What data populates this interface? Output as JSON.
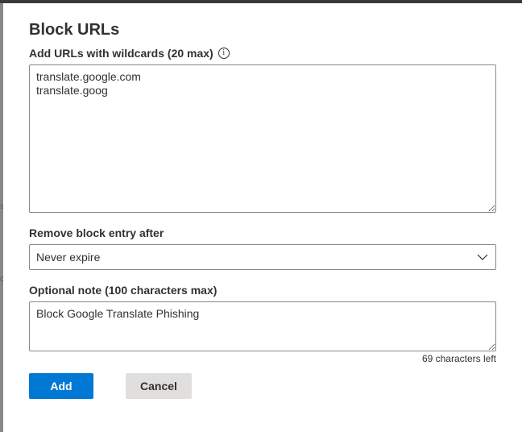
{
  "dialog": {
    "title": "Block URLs",
    "urls_label": "Add URLs with wildcards (20 max)",
    "info_glyph": "i",
    "urls_value": "translate.google.com\ntranslate.goog",
    "expiry_label": "Remove block entry after",
    "expiry_selected": "Never expire",
    "note_label": "Optional note (100 characters max)",
    "note_value": "Block Google Translate Phishing",
    "chars_left": "69 characters left",
    "add_label": "Add",
    "cancel_label": "Cancel"
  },
  "colors": {
    "primary": "#0078d4",
    "secondary_bg": "#e1dfdd",
    "border": "#8a8886",
    "text": "#323130"
  },
  "icons": [
    "info-icon",
    "chevron-down-icon",
    "resize-grip-icon"
  ]
}
